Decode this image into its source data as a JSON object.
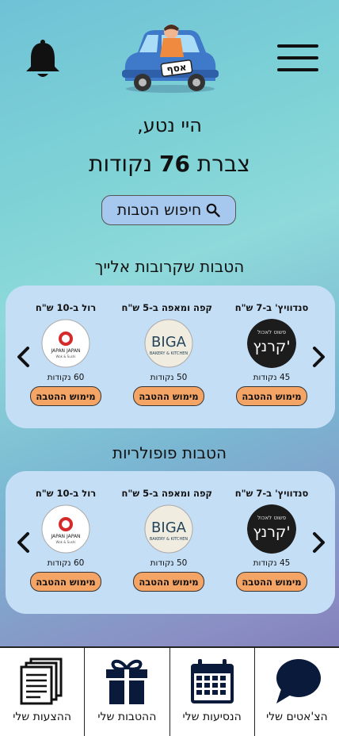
{
  "header": {
    "menu_icon": "hamburger-menu-icon",
    "bell_icon": "bell-icon",
    "logo_text": "אסף"
  },
  "greeting": "היי נטע,",
  "points_summary": {
    "prefix": "צברת",
    "value": "76",
    "suffix": "נקודות"
  },
  "search_button": {
    "label": "חיפוש הטבות",
    "icon": "search-icon"
  },
  "sections": [
    {
      "title": "הטבות שקרובות אלייך",
      "offers": [
        {
          "title": "סנדוויץ' ב-7 ש\"ח",
          "logo": "kranch",
          "logo_text": "קרנץ'",
          "logo_subtext": "פשוט לאכול",
          "points": "45 נקודות",
          "button": "מימוש ההטבה"
        },
        {
          "title": "קפה ומאפה ב-5 ש\"ח",
          "logo": "biga",
          "logo_text": "BIGA",
          "logo_subtext": "BAKERY & KITCHEN",
          "points": "50 נקודות",
          "button": "מימוש ההטבה"
        },
        {
          "title": "רול ב-10 ש\"ח",
          "logo": "japan-japan",
          "logo_text": "JAPAN JAPAN",
          "logo_subtext": "Wok & Sushi",
          "points": "60 נקודות",
          "button": "מימוש ההטבה"
        }
      ]
    },
    {
      "title": "הטבות פופולריות",
      "offers": [
        {
          "title": "סנדוויץ' ב-7 ש\"ח",
          "logo": "kranch",
          "logo_text": "קרנץ'",
          "logo_subtext": "פשוט לאכול",
          "points": "45 נקודות",
          "button": "מימוש ההטבה"
        },
        {
          "title": "קפה ומאפה ב-5 ש\"ח",
          "logo": "biga",
          "logo_text": "BIGA",
          "logo_subtext": "BAKERY & KITCHEN",
          "points": "50 נקודות",
          "button": "מימוש ההטבה"
        },
        {
          "title": "רול ב-10 ש\"ח",
          "logo": "japan-japan",
          "logo_text": "JAPAN JAPAN",
          "logo_subtext": "Wok & Sushi",
          "points": "60 נקודות",
          "button": "מימוש ההטבה"
        }
      ]
    }
  ],
  "bottom_nav": [
    {
      "label": "הצ'אטים שלי",
      "icon": "chat-bubble-icon"
    },
    {
      "label": "הנסיעות שלי",
      "icon": "calendar-icon"
    },
    {
      "label": "ההטבות שלי",
      "icon": "gift-icon"
    },
    {
      "label": "ההצעות שלי",
      "icon": "documents-icon"
    }
  ],
  "colors": {
    "card_bg": "#c4def6",
    "button_orange": "#f4a464",
    "search_bg": "#a7c8ee"
  }
}
